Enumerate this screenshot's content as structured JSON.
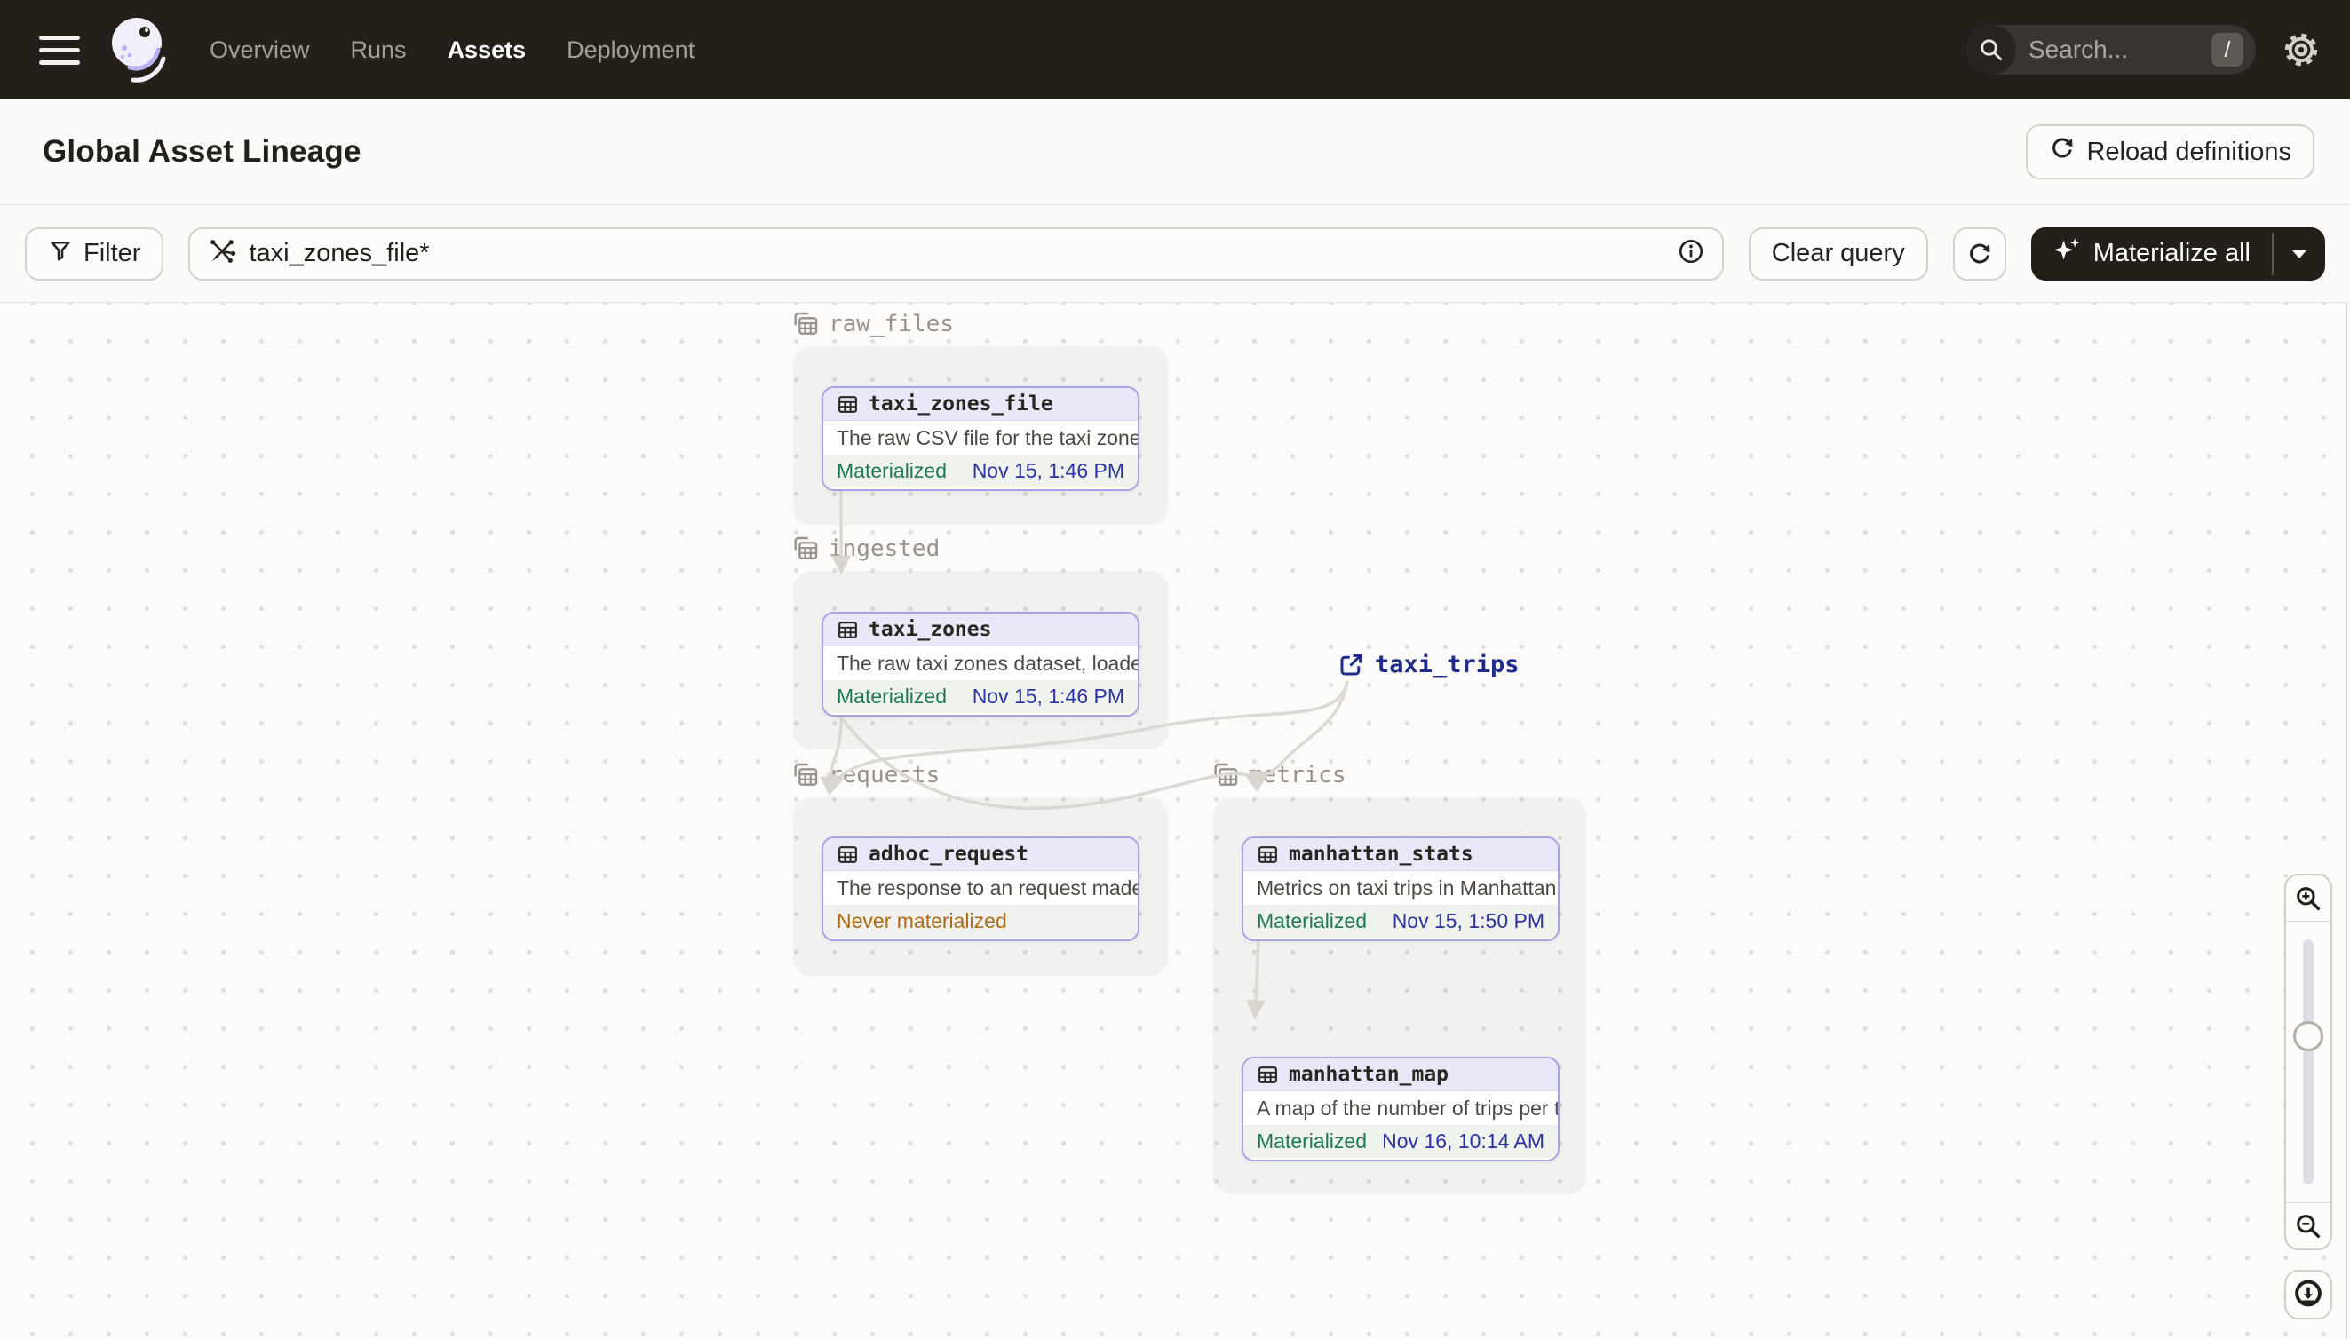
{
  "app": {
    "name": "Dagster"
  },
  "nav": {
    "items": [
      {
        "label": "Overview",
        "active": false
      },
      {
        "label": "Runs",
        "active": false
      },
      {
        "label": "Assets",
        "active": true
      },
      {
        "label": "Deployment",
        "active": false
      }
    ],
    "search": {
      "placeholder": "Search...",
      "shortcut": "/"
    }
  },
  "header": {
    "title": "Global Asset Lineage",
    "reload_button": "Reload definitions"
  },
  "toolbar": {
    "filter_button": "Filter",
    "query_value": "taxi_zones_file*",
    "clear_button": "Clear query",
    "materialize_button": "Materialize all"
  },
  "graph": {
    "groups": [
      {
        "name": "raw_files"
      },
      {
        "name": "ingested"
      },
      {
        "name": "requests"
      },
      {
        "name": "metrics"
      }
    ],
    "nodes": [
      {
        "name": "taxi_zones_file",
        "group": "raw_files",
        "description": "The raw CSV file for the taxi zones dat...",
        "status": "Materialized",
        "timestamp": "Nov 15, 1:46 PM"
      },
      {
        "name": "taxi_zones",
        "group": "ingested",
        "description": "The raw taxi zones dataset, loaded int...",
        "status": "Materialized",
        "timestamp": "Nov 15, 1:46 PM"
      },
      {
        "name": "adhoc_request",
        "group": "requests",
        "description": "The response to an request made in th...",
        "status": "Never materialized",
        "timestamp": ""
      },
      {
        "name": "manhattan_stats",
        "group": "metrics",
        "description": "Metrics on taxi trips in Manhattan",
        "status": "Materialized",
        "timestamp": "Nov 15, 1:50 PM"
      },
      {
        "name": "manhattan_map",
        "group": "metrics",
        "description": "A map of the number of trips per taxi z...",
        "status": "Materialized",
        "timestamp": "Nov 16, 10:14 AM"
      }
    ],
    "external_assets": [
      {
        "name": "taxi_trips"
      }
    ]
  },
  "colors": {
    "nav_bg": "#242019",
    "accent_purple": "#A7A2E3",
    "node_header_bg": "#E9E8F9",
    "materialized_green": "#1E7A51",
    "never_materialized_orange": "#AF6A14",
    "timestamp_navy": "#2A33A0",
    "external_link_navy": "#1F2C8E",
    "edge_gray": "#DCD8D2"
  }
}
